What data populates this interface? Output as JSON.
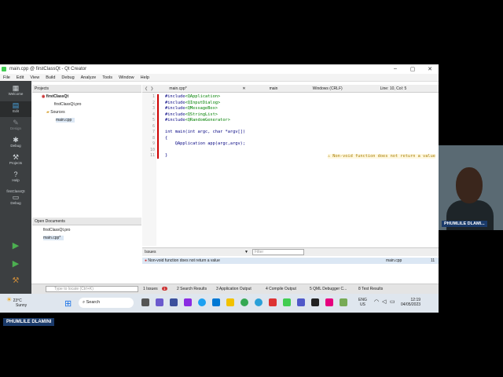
{
  "window": {
    "title": "main.cpp @ firstClassQt - Qt Creator",
    "controls": [
      "–",
      "▢",
      "✕"
    ]
  },
  "menu": [
    "File",
    "Edit",
    "View",
    "Build",
    "Debug",
    "Analyze",
    "Tools",
    "Window",
    "Help"
  ],
  "modes": {
    "welcome": "Welcome",
    "edit": "Edit",
    "design": "Design",
    "debug": "Debug",
    "projects": "Projects",
    "help": "Help",
    "kit": "firstClassQt",
    "kit_mode": "Debug"
  },
  "projects_panel": {
    "header": "Projects",
    "project": "firstClassQt",
    "pro_file": "firstClassQt.pro",
    "sources": "Sources",
    "source_file": "main.cpp"
  },
  "open_documents": {
    "header": "Open Documents",
    "items": [
      "firstClassQt.pro",
      "main.cpp*"
    ]
  },
  "editor": {
    "file": "main.cpp*",
    "symbol": "main",
    "line_ending": "Windows (CRLF)",
    "position": "Line: 10, Col: 5",
    "lines": [
      {
        "n": "1",
        "pre": "#include",
        "hdr": "<QApplication>"
      },
      {
        "n": "2",
        "pre": "#include",
        "hdr": "<QInputDialog>"
      },
      {
        "n": "3",
        "pre": "#include",
        "hdr": "<QMessageBox>"
      },
      {
        "n": "4",
        "pre": "#include",
        "hdr": "<QStringList>"
      },
      {
        "n": "5",
        "pre": "#include",
        "hdr": "<QRandomGenerator>"
      },
      {
        "n": "6",
        "pre": "",
        "hdr": ""
      },
      {
        "n": "7",
        "pre": "int main(int argc, char *argv[])",
        "hdr": ""
      },
      {
        "n": "8",
        "pre": "{",
        "hdr": ""
      },
      {
        "n": "9",
        "pre": "    QApplication app(argc,argv);",
        "hdr": ""
      },
      {
        "n": "10",
        "pre": "",
        "hdr": ""
      },
      {
        "n": "11",
        "pre": "}",
        "hdr": ""
      }
    ],
    "warning": "Non-void function does not return a value"
  },
  "issues": {
    "label": "Issues",
    "filter_placeholder": "Filter",
    "row_text": "Non-void function does not return a value",
    "row_file": "main.cpp",
    "row_line": "11"
  },
  "bottom": {
    "locator_placeholder": "Type to locate (Ctrl+K)",
    "tabs": [
      "1 Issues",
      "2 Search Results",
      "3 Application Output",
      "4 Compile Output",
      "5 QML Debugger C...",
      "8 Test Results"
    ],
    "issue_count": "1"
  },
  "taskbar": {
    "weather_temp": "23°C",
    "weather_desc": "Sunny",
    "search": "Search",
    "lang": "ENG",
    "region": "US",
    "time": "12:19",
    "date": "04/05/2023"
  },
  "participant": {
    "cam_name": "PHUMLILE DLAMI...",
    "speaker_name": "PHUMLILE DLAMINI"
  }
}
